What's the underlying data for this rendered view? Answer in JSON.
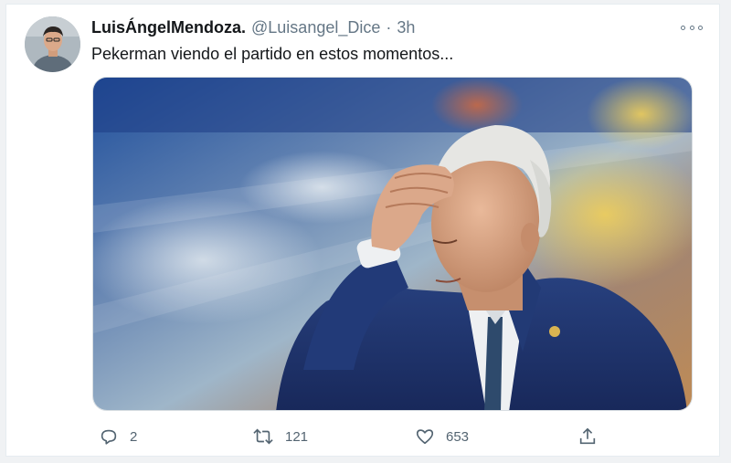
{
  "tweet": {
    "display_name": "LuisÁngelMendoza.",
    "handle": "@Luisangel_Dice",
    "separator": "·",
    "time": "3h",
    "text": "Pekerman viendo el partido en estos momentos...",
    "media": {
      "description_icon": "photo"
    },
    "actions": {
      "reply_count": "2",
      "retweet_count": "121",
      "like_count": "653"
    }
  },
  "icons": {
    "reply": "reply-icon",
    "retweet": "retweet-icon",
    "like": "heart-icon",
    "share": "share-icon",
    "more": "more-icon"
  },
  "colors": {
    "text_primary": "#14171a",
    "text_secondary": "#657786",
    "suit_blue": "#1f3472"
  }
}
